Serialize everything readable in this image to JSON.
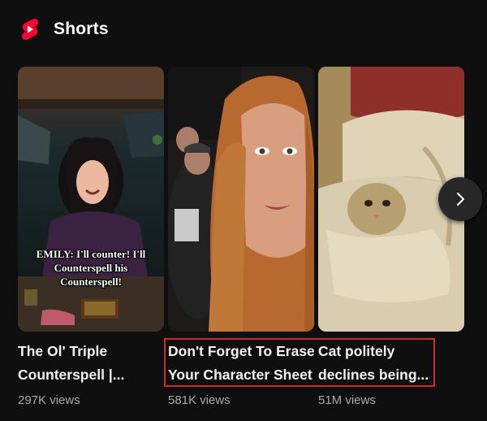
{
  "section": {
    "title": "Shorts",
    "icon": "shorts-logo-icon",
    "brand_color": "#ff0033"
  },
  "shorts": [
    {
      "title_lines": [
        "The Ol' Triple",
        "Counterspell |..."
      ],
      "views": "297K views",
      "caption_lines": [
        "EMILY: I'll counter! I'll",
        "Counterspell his",
        "Counterspell!"
      ]
    },
    {
      "title_lines": [
        "Don't Forget To Erase",
        "Your Character Sheet"
      ],
      "views": "581K views"
    },
    {
      "title_lines": [
        "Cat politely",
        "declines being..."
      ],
      "views": "51M views"
    }
  ],
  "next_button": {
    "icon": "chevron-right-icon"
  },
  "highlight_color": "#d42a2a"
}
